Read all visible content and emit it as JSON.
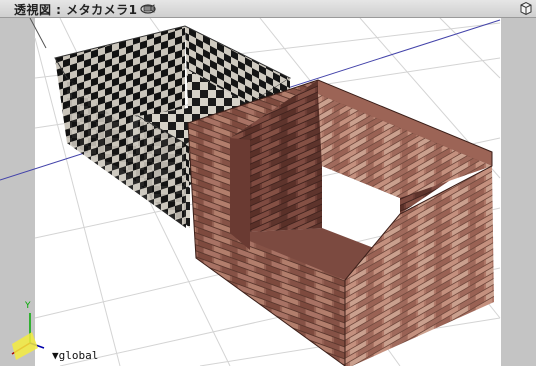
{
  "titlebar": {
    "view_title": "透視図 : メタカメラ1",
    "camera_icon": "camera-rotate-icon",
    "options_icon": "cube-options-icon"
  },
  "viewport": {
    "background_color": "#c4c4c4",
    "render_area_color": "#ffffff",
    "grid_color": "#d2d2d2",
    "axis_line_color": "#4444aa",
    "objects": [
      {
        "name": "checker-box",
        "texture": "checkerboard"
      },
      {
        "name": "brick-box",
        "texture": "brick"
      }
    ]
  },
  "gizmo": {
    "axis_y_label": "Y",
    "coordinate_space": "▼global"
  }
}
